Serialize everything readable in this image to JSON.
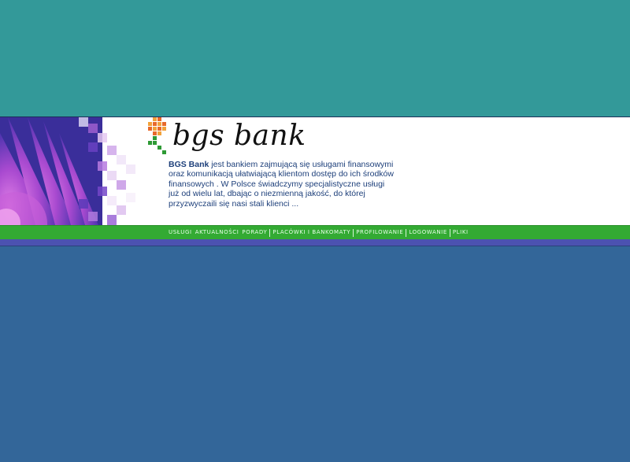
{
  "logo": {
    "text": "bgs bank"
  },
  "intro": {
    "brand": "BGS Bank",
    "line1_rest": " jest bankiem zajmującą się usługami finansowymi",
    "line2": "oraz komunikacją ułatwiającą klientom dostęp do ich środków",
    "line3": "finansowych . W Polsce świadczymy specjalistyczne usługi",
    "line4": "już od wielu lat, dbając o niezmienną jakość, do której",
    "line5": "przyzwyczaili się nasi stali klienci ..."
  },
  "nav": {
    "items": [
      {
        "label": "USŁUGI"
      },
      {
        "label": "AKTUALNOŚCI"
      },
      {
        "label": "PORADY"
      },
      {
        "label": "PLACÓWKI I BANKOMATY"
      },
      {
        "label": "PROFILOWANIE"
      },
      {
        "label": "LOGOWANIE"
      },
      {
        "label": "PLIKI"
      }
    ]
  },
  "colors": {
    "top_background": "#339999",
    "bottom_background": "#336699",
    "nav_green": "#33aa33",
    "text_blue": "#1d3f7a",
    "stripe_purple": "#4c52b0"
  }
}
